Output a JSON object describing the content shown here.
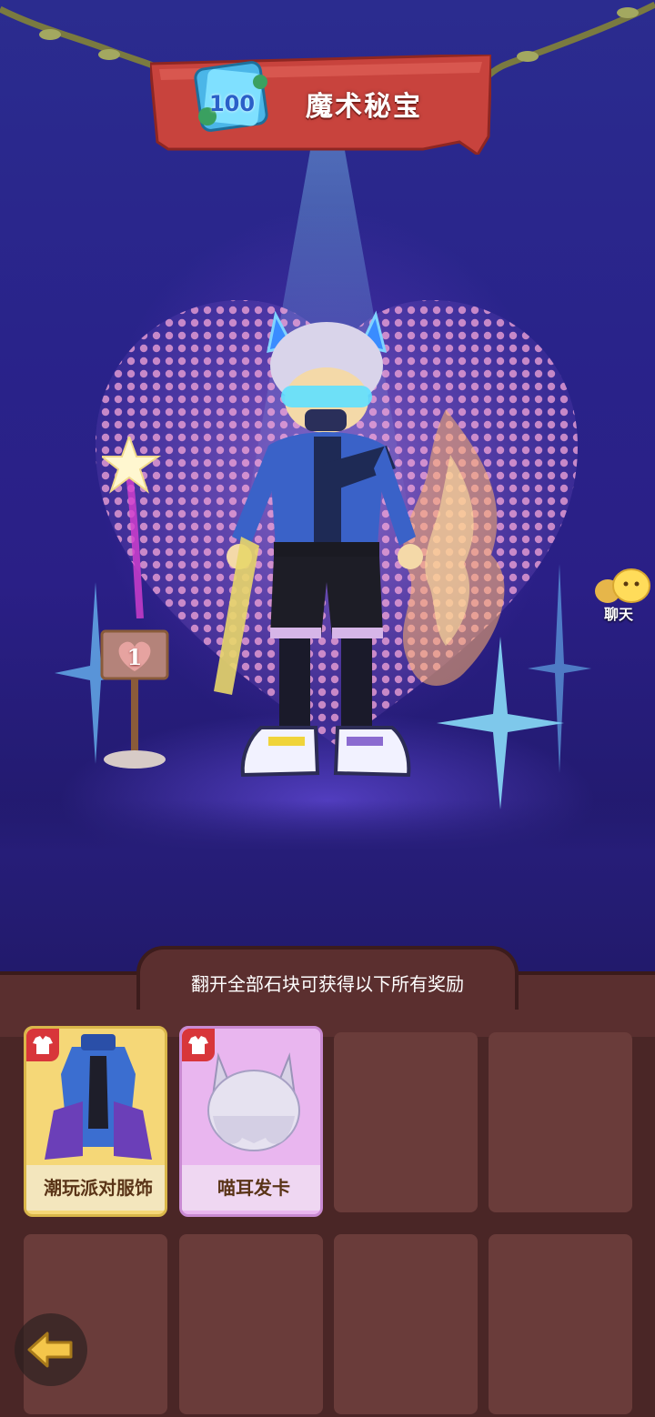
{
  "header": {
    "title": "魔术秘宝",
    "badge_icon": "card-pack-icon",
    "badge_number": "100"
  },
  "stage": {
    "sign_number": "1",
    "chat_label": "聊天",
    "chat_icon": "chat-bubble-icon"
  },
  "rewards": {
    "title": "翻开全部石块可获得以下所有奖励",
    "items": [
      {
        "name": "潮玩派对服饰",
        "icon": "outfit-icon",
        "tag_icon": "shirt-tag-icon",
        "color": "#f5d777"
      },
      {
        "name": "喵耳发卡",
        "icon": "cat-ear-hair-icon",
        "tag_icon": "shirt-tag-icon",
        "color": "#e9b6ef"
      }
    ],
    "empty_slot_count": 6
  },
  "nav": {
    "back_icon": "back-arrow-icon"
  },
  "colors": {
    "banner": "#c8433d",
    "panel": "#5a2f2f",
    "slot": "#6a3c3a",
    "stage": "#2a2388"
  }
}
